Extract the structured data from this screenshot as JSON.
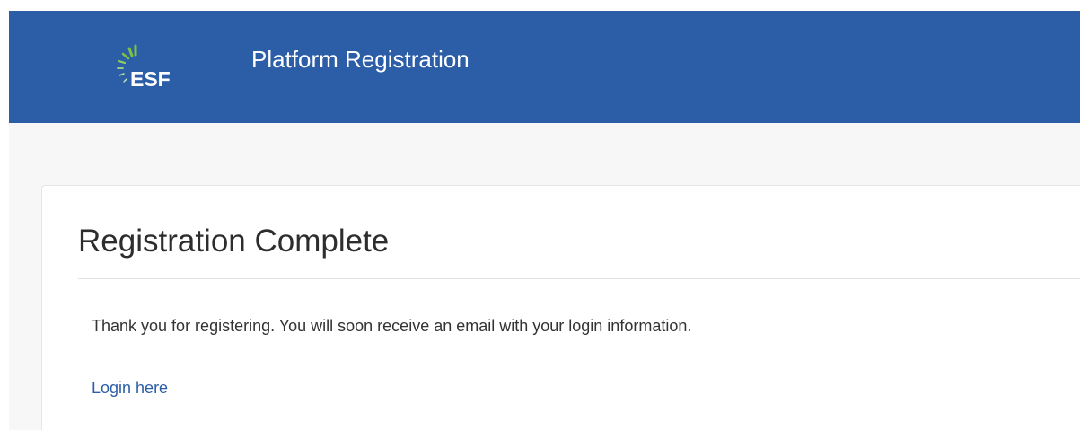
{
  "header": {
    "logo_text": "ESF",
    "title": "Platform Registration",
    "background_color": "#2c5ea8",
    "logo_accent_color": "#7dc242"
  },
  "card": {
    "title": "Registration Complete",
    "message": "Thank you for registering. You will soon receive an email with your login information.",
    "login_link_label": "Login here",
    "link_color": "#2c5ea8"
  }
}
